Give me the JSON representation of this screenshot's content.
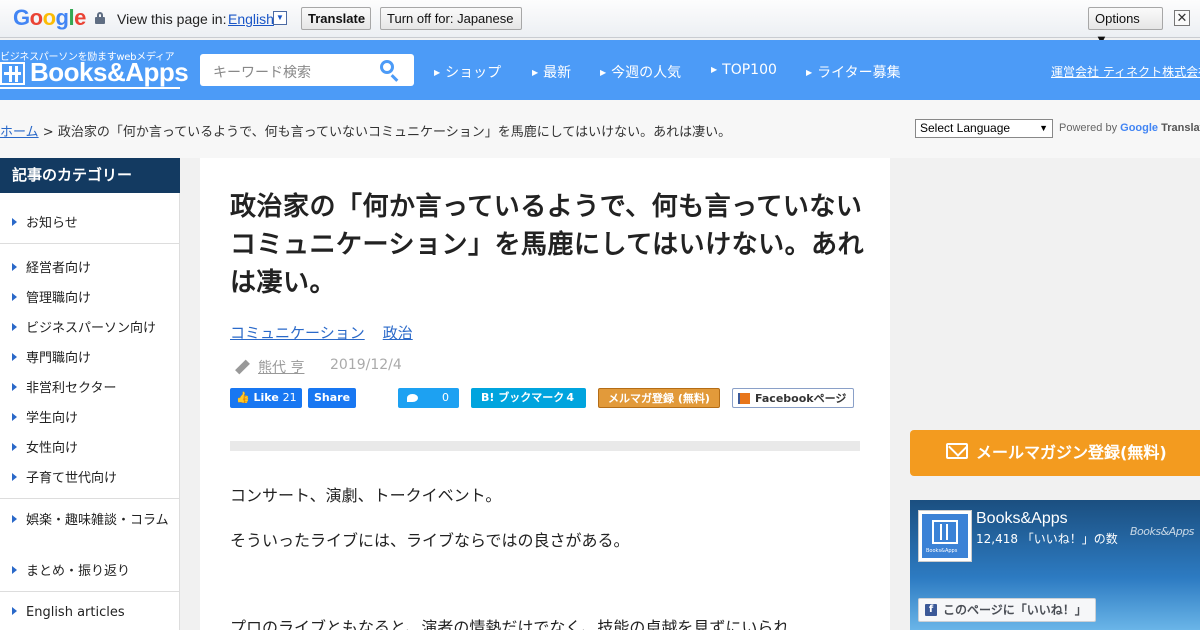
{
  "translate_bar": {
    "logo": [
      "G",
      "o",
      "o",
      "g",
      "l",
      "e"
    ],
    "view_label": "View this page in:",
    "language": "English",
    "translate_button": "Translate",
    "turnoff_button": "Turn off for: Japanese",
    "options_button": "Options ▼",
    "close_glyph": "✕"
  },
  "header": {
    "tagline": "ビジネスパーソンを励ますwebメディア",
    "logo_text": "Books&Apps",
    "search_placeholder": "キーワード検索",
    "nav": [
      "ショップ",
      "最新",
      "今週の人気",
      "TOP100",
      "ライター募集"
    ],
    "company_link": "運営会社 ティネクト株式会社"
  },
  "breadcrumb": {
    "home": "ホーム",
    "separator": ">",
    "current": "政治家の「何か言っているようで、何も言っていないコミュニケーション」を馬鹿にしてはいけない。あれは凄い。"
  },
  "language_select": {
    "selected": "Select Language",
    "powered_by": "Powered by",
    "google": "Google",
    "translate": "Translate"
  },
  "sidebar": {
    "heading": "記事のカテゴリー",
    "items": [
      "お知らせ",
      "経営者向け",
      "管理職向け",
      "ビジネスパーソン向け",
      "専門職向け",
      "非営利セクター",
      "学生向け",
      "女性向け",
      "子育て世代向け",
      "娯楽・趣味雑談・コラム",
      "まとめ・振り返り",
      "English articles"
    ]
  },
  "article": {
    "title": "政治家の「何か言っているようで、何も言っていないコミュニケーション」を馬鹿にしてはいけない。あれは凄い。",
    "tags": [
      "コミュニケーション",
      "政治"
    ],
    "author": "熊代 亨",
    "date": "2019/12/4",
    "share": {
      "fb_like": "Like",
      "fb_like_count": "21",
      "fb_share": "Share",
      "twitter_count": "0",
      "hatena_label": "B! ブックマーク",
      "hatena_count": "4",
      "mail_label": "メルマガ登録 (無料)",
      "fb_page_label": "Facebookページ"
    },
    "paragraphs": [
      "コンサート、演劇、トークイベント。",
      "そういったライブには、ライブならではの良さがある。",
      "プロのライブともなると、演者の情熱だけでなく、技能の卓越を見ずにいられ"
    ]
  },
  "right": {
    "mailmag_label": "メールマガジン登録(無料)",
    "fb_widget": {
      "name": "Books&Apps",
      "count": "12,418 「いいね！」の数",
      "watermark": "Books&Apps",
      "thumb_label": "Books&Apps",
      "like_button": "このページに「いいね！」",
      "f_glyph": "f"
    }
  },
  "colors": {
    "header_blue": "#4c9bf7",
    "sidebar_head": "#133a61",
    "link": "#2a69c9",
    "orange": "#f39b1f"
  }
}
